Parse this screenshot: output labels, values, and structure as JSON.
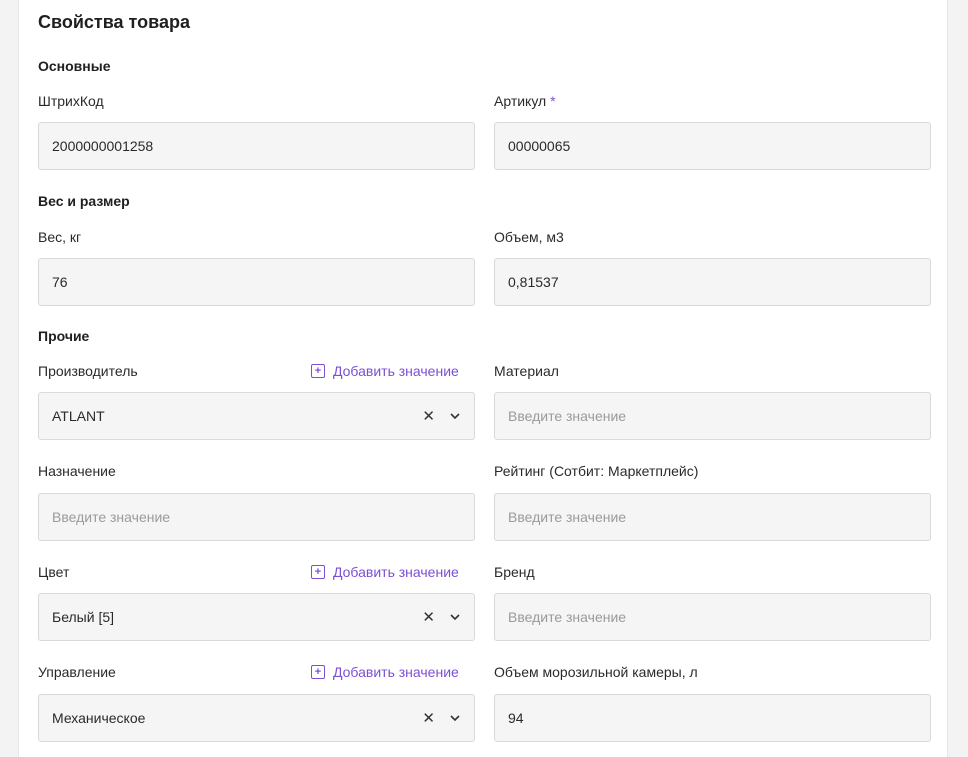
{
  "page": {
    "title": "Свойства товара"
  },
  "sections": {
    "basic": "Основные",
    "weight_size": "Вес и размер",
    "other": "Прочие"
  },
  "fields": {
    "barcode": {
      "label": "ШтрихКод",
      "value": "2000000001258"
    },
    "sku": {
      "label": "Артикул",
      "required_mark": "*",
      "value": "00000065"
    },
    "weight": {
      "label": "Вес, кг",
      "value": "76"
    },
    "volume": {
      "label": "Объем, м3",
      "value": "0,81537"
    },
    "manufacturer": {
      "label": "Производитель",
      "value": "ATLANT",
      "add_label": "Добавить значение"
    },
    "material": {
      "label": "Материал",
      "placeholder": "Введите значение"
    },
    "purpose": {
      "label": "Назначение",
      "placeholder": "Введите значение"
    },
    "rating": {
      "label": "Рейтинг (Сотбит: Маркетплейс)",
      "placeholder": "Введите значение"
    },
    "color": {
      "label": "Цвет",
      "value": "Белый [5]",
      "add_label": "Добавить значение"
    },
    "brand": {
      "label": "Бренд",
      "placeholder": "Введите значение"
    },
    "control": {
      "label": "Управление",
      "value": "Механическое",
      "add_label": "Добавить значение"
    },
    "freezer_volume": {
      "label": "Объем морозильной камеры, л",
      "value": "94"
    }
  },
  "icons": {
    "clear": "✕",
    "plus": "+"
  },
  "colors": {
    "accent": "#7b4fd6",
    "field_bg": "#f5f5f6",
    "field_border": "#d9d9dc",
    "placeholder": "#9a9a9e"
  }
}
